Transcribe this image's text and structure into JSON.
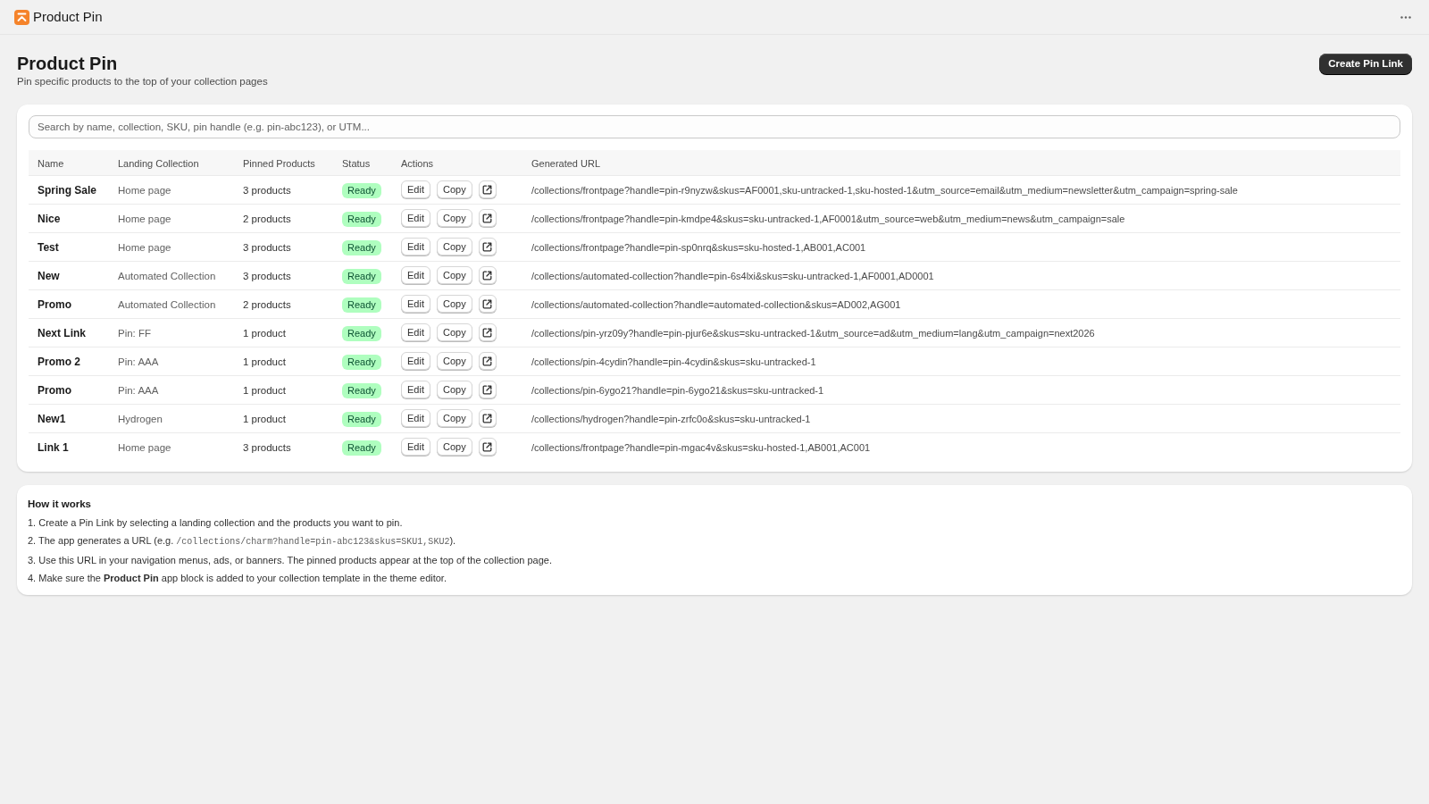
{
  "app_bar": {
    "title": "Product Pin"
  },
  "page": {
    "title": "Product Pin",
    "subtitle": "Pin specific products to the top of your collection pages",
    "primary_action": "Create Pin Link"
  },
  "search": {
    "placeholder": "Search by name, collection, SKU, pin handle (e.g. pin-abc123), or UTM..."
  },
  "table": {
    "columns": [
      "Name",
      "Landing Collection",
      "Pinned Products",
      "Status",
      "Actions",
      "Generated URL"
    ],
    "rows": [
      {
        "name": "Spring Sale",
        "landing_collection": "Home page",
        "pinned_products": "3 products",
        "status": "Ready",
        "actions": [
          "Edit",
          "Copy"
        ],
        "generated_url": "/collections/frontpage?handle=pin-r9nyzw&skus=AF0001,sku-untracked-1,sku-hosted-1&utm_source=email&utm_medium=newsletter&utm_campaign=spring-sale"
      },
      {
        "name": "Nice",
        "landing_collection": "Home page",
        "pinned_products": "2 products",
        "status": "Ready",
        "actions": [
          "Edit",
          "Copy"
        ],
        "generated_url": "/collections/frontpage?handle=pin-kmdpe4&skus=sku-untracked-1,AF0001&utm_source=web&utm_medium=news&utm_campaign=sale"
      },
      {
        "name": "Test",
        "landing_collection": "Home page",
        "pinned_products": "3 products",
        "status": "Ready",
        "actions": [
          "Edit",
          "Copy"
        ],
        "generated_url": "/collections/frontpage?handle=pin-sp0nrq&skus=sku-hosted-1,AB001,AC001"
      },
      {
        "name": "New",
        "landing_collection": "Automated Collection",
        "pinned_products": "3 products",
        "status": "Ready",
        "actions": [
          "Edit",
          "Copy"
        ],
        "generated_url": "/collections/automated-collection?handle=pin-6s4lxi&skus=sku-untracked-1,AF0001,AD0001"
      },
      {
        "name": "Promo",
        "landing_collection": "Automated Collection",
        "pinned_products": "2 products",
        "status": "Ready",
        "actions": [
          "Edit",
          "Copy"
        ],
        "generated_url": "/collections/automated-collection?handle=automated-collection&skus=AD002,AG001"
      },
      {
        "name": "Next Link",
        "landing_collection": "Pin: FF",
        "pinned_products": "1 product",
        "status": "Ready",
        "actions": [
          "Edit",
          "Copy"
        ],
        "generated_url": "/collections/pin-yrz09y?handle=pin-pjur6e&skus=sku-untracked-1&utm_source=ad&utm_medium=lang&utm_campaign=next2026"
      },
      {
        "name": "Promo 2",
        "landing_collection": "Pin: AAA",
        "pinned_products": "1 product",
        "status": "Ready",
        "actions": [
          "Edit",
          "Copy"
        ],
        "generated_url": "/collections/pin-4cydin?handle=pin-4cydin&skus=sku-untracked-1"
      },
      {
        "name": "Promo",
        "landing_collection": "Pin: AAA",
        "pinned_products": "1 product",
        "status": "Ready",
        "actions": [
          "Edit",
          "Copy"
        ],
        "generated_url": "/collections/pin-6ygo21?handle=pin-6ygo21&skus=sku-untracked-1"
      },
      {
        "name": "New1",
        "landing_collection": "Hydrogen",
        "pinned_products": "1 product",
        "status": "Ready",
        "actions": [
          "Edit",
          "Copy"
        ],
        "generated_url": "/collections/hydrogen?handle=pin-zrfc0o&skus=sku-untracked-1"
      },
      {
        "name": "Link 1",
        "landing_collection": "Home page",
        "pinned_products": "3 products",
        "status": "Ready",
        "actions": [
          "Edit",
          "Copy"
        ],
        "generated_url": "/collections/frontpage?handle=pin-mgac4v&skus=sku-hosted-1,AB001,AC001"
      }
    ]
  },
  "how_it_works": {
    "title": "How it works",
    "steps": [
      {
        "parts": [
          {
            "kind": "text",
            "text": "1. Create a Pin Link by selecting a landing collection and the products you want to pin."
          }
        ]
      },
      {
        "parts": [
          {
            "kind": "text",
            "text": "2. The app generates a URL (e.g. "
          },
          {
            "kind": "code",
            "text": "/collections/charm?handle=pin-abc123&skus=SKU1,SKU2"
          },
          {
            "kind": "text",
            "text": ")."
          }
        ]
      },
      {
        "parts": [
          {
            "kind": "text",
            "text": "3. Use this URL in your navigation menus, ads, or banners. The pinned products appear at the top of the collection page."
          }
        ]
      },
      {
        "parts": [
          {
            "kind": "text",
            "text": "4. Make sure the **Product Pin** app block is added to your collection template in the theme editor."
          }
        ]
      }
    ]
  }
}
